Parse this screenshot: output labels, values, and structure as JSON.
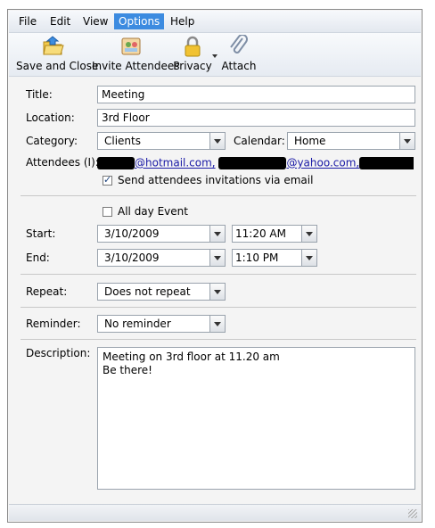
{
  "menubar": {
    "items": [
      {
        "label": "File"
      },
      {
        "label": "Edit"
      },
      {
        "label": "View"
      },
      {
        "label": "Options"
      },
      {
        "label": "Help"
      }
    ]
  },
  "toolbar": {
    "save_close": "Save and Close",
    "invite": "Invite Attendees",
    "privacy": "Privacy",
    "attach": "Attach"
  },
  "form": {
    "title_label": "Title:",
    "title_value": "Meeting",
    "location_label": "Location:",
    "location_value": "3rd Floor",
    "category_label": "Category:",
    "category_value": "Clients",
    "calendar_label": "Calendar:",
    "calendar_value": "Home",
    "attendees_label": "Attendees (I):",
    "attendee_domain_1": "@hotmail.com,",
    "attendee_domain_2": "@yahoo.com,",
    "send_invites_label": "Send attendees invitations via email",
    "send_invites_checked": true,
    "all_day_label": "All day Event",
    "all_day_checked": false,
    "start_label": "Start:",
    "start_date": "3/10/2009",
    "start_time": "11:20 AM",
    "end_label": "End:",
    "end_date": "3/10/2009",
    "end_time": "1:10 PM",
    "repeat_label": "Repeat:",
    "repeat_value": "Does not repeat",
    "reminder_label": "Reminder:",
    "reminder_value": "No reminder",
    "description_label": "Description:",
    "description_value": "Meeting on 3rd floor at 11.20 am\nBe there!"
  },
  "colors": {
    "menu_active": "#3c8be0",
    "link": "#1a1aa6"
  }
}
